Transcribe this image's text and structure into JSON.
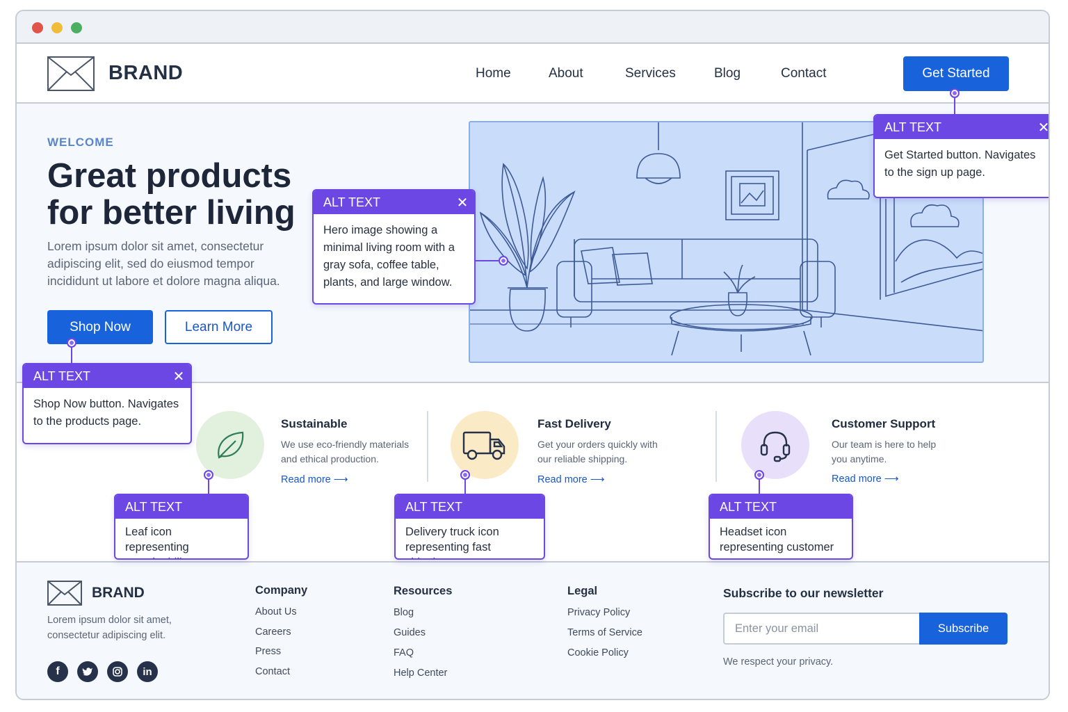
{
  "header": {
    "brand": "BRAND",
    "nav": [
      "Home",
      "About",
      "Services",
      "Blog",
      "Contact"
    ],
    "cta": "Get Started"
  },
  "hero": {
    "eyebrow": "WELCOME",
    "headline_line1": "Great products",
    "headline_line2": "for better living",
    "text": "Lorem ipsum dolor sit amet, consectetur adipiscing elit, sed do eiusmod tempor incididunt ut labore et dolore magna aliqua.",
    "primary_btn": "Shop Now",
    "secondary_btn": "Learn More"
  },
  "alt_tips": {
    "heading": "ALT TEXT",
    "close_glyph": "✕",
    "get_started": "Get Started button. Navigates to the sign up page.",
    "hero_image": "Hero image showing a minimal living room with a gray sofa, coffee table, plants, and large window.",
    "shop_now": "Shop Now button. Navigates to the products page.",
    "leaf": "Leaf icon representing sustainability.",
    "truck": "Delivery truck icon representing fast shipping.",
    "headset": "Headset icon representing customer support."
  },
  "features": [
    {
      "title": "Sustainable",
      "text": "We use eco-friendly materials and ethical production.",
      "link": "Read more",
      "icon": "leaf-icon",
      "color": "#e2f1de"
    },
    {
      "title": "Fast Delivery",
      "text": "Get your orders quickly with our reliable shipping.",
      "link": "Read more",
      "icon": "truck-icon",
      "color": "#fbeac6"
    },
    {
      "title": "Customer Support",
      "text": "Our team is here to help you anytime.",
      "link": "Read more",
      "icon": "headset-icon",
      "color": "#e8e0fb"
    }
  ],
  "footer": {
    "brand": "BRAND",
    "about": "Lorem ipsum dolor sit amet, consectetur adipiscing elit.",
    "columns": [
      {
        "title": "Company",
        "links": [
          "About Us",
          "Careers",
          "Press",
          "Contact"
        ]
      },
      {
        "title": "Resources",
        "links": [
          "Blog",
          "Guides",
          "FAQ",
          "Help Center"
        ]
      },
      {
        "title": "Legal",
        "links": [
          "Privacy Policy",
          "Terms of Service",
          "Cookie Policy"
        ]
      }
    ],
    "newsletter_title": "Subscribe to our newsletter",
    "email_placeholder": "Enter your email",
    "subscribe": "Subscribe",
    "privacy": "We respect your privacy.",
    "socials": [
      "facebook-icon",
      "twitter-icon",
      "instagram-icon",
      "linkedin-icon"
    ]
  },
  "colors": {
    "accent": "#1863dc",
    "alt_purple": "#6d47e3",
    "text_dark": "#1d2739"
  }
}
